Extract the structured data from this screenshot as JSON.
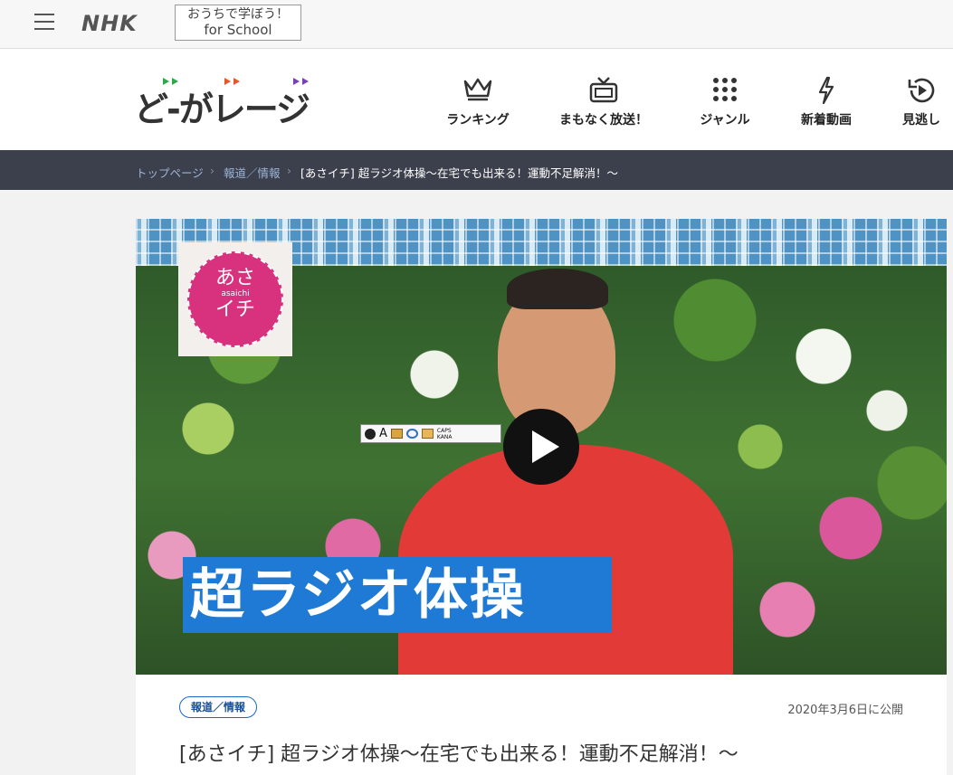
{
  "topbar": {
    "brand": "NHK",
    "school_line1": "おうちで学ぼう！",
    "school_line2": "for School"
  },
  "header": {
    "logo_text": "ど-がレージ",
    "nav": [
      {
        "label": "ランキング",
        "icon": "crown-icon"
      },
      {
        "label": "まもなく放送！",
        "icon": "tv-icon"
      },
      {
        "label": "ジャンル",
        "icon": "grid-dots-icon"
      },
      {
        "label": "新着動画",
        "icon": "lightning-icon"
      },
      {
        "label": "見逃し",
        "icon": "replay-icon"
      }
    ],
    "logo_colors": [
      "#2aa84a",
      "#e5572a",
      "#7b3fb5"
    ]
  },
  "breadcrumb": {
    "items": [
      "トップページ",
      "報道／情報"
    ],
    "separator": "›",
    "current": "[あさイチ] 超ラジオ体操〜在宅でも出来る！運動不足解消！〜"
  },
  "video": {
    "badge_line1": "あさ",
    "badge_line2": "asaichi",
    "badge_line3": "イチ",
    "caption": "超ラジオ体操",
    "ime_caps": "CAPS",
    "ime_kana": "KANA",
    "ime_letter": "A",
    "play_icon": "play-icon"
  },
  "article": {
    "tag": "報道／情報",
    "date": "2020年3月6日に公開",
    "title": "[あさイチ] 超ラジオ体操〜在宅でも出来る！運動不足解消！〜"
  },
  "colors": {
    "breadcrumb_bg": "#3c404c",
    "tag_blue": "#1a67c4",
    "caption_blue": "#1f7ad6",
    "badge_pink": "#d8317d"
  }
}
